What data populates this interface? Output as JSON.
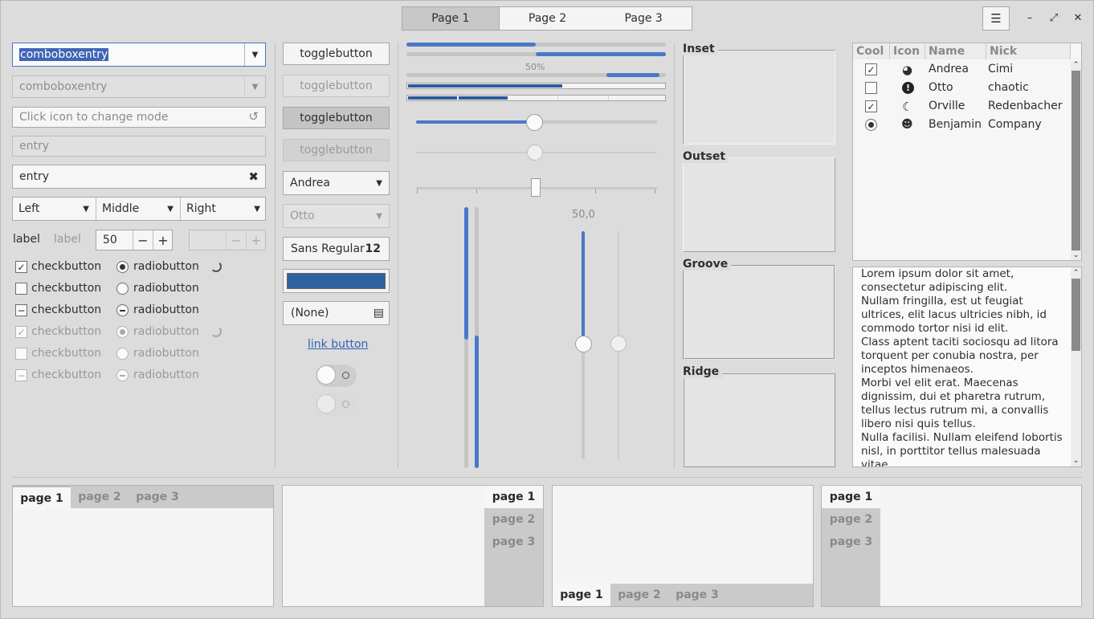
{
  "header": {
    "stack_tabs": [
      "Page 1",
      "Page 2",
      "Page 3"
    ],
    "menu_icon": "hamburger-icon",
    "controls": {
      "minimize": "–",
      "maximize": "⤢",
      "close": "✕"
    }
  },
  "left": {
    "combo1": "comboboxentry",
    "combo2": "comboboxentry",
    "mode_placeholder": "Click icon to change mode",
    "entry_disabled": "entry",
    "entry": "entry",
    "combos": [
      "Left",
      "Middle",
      "Right"
    ],
    "label1": "label",
    "label2": "label",
    "spin_value": "50",
    "spin_minus": "−",
    "spin_plus": "+",
    "check_label": "checkbutton",
    "radio_label": "radiobutton"
  },
  "buttons": {
    "toggle": "togglebutton",
    "combo_andrea": "Andrea",
    "combo_otto": "Otto",
    "font_name": "Sans Regular",
    "font_size": "12",
    "file_none": "(None)",
    "link": "link button",
    "color": "#2f62a0"
  },
  "progress": {
    "label": "50%",
    "scale_value": "50,0",
    "scale_fraction": 0.5
  },
  "frames": [
    "Inset",
    "Outset",
    "Groove",
    "Ridge"
  ],
  "tree": {
    "columns": [
      "Cool",
      "Icon",
      "Name",
      "Nick"
    ],
    "rows": [
      {
        "cool": "check",
        "icon": "pie-icon",
        "name": "Andrea",
        "nick": "Cimi"
      },
      {
        "cool": "empty",
        "icon": "alert-icon",
        "name": "Otto",
        "nick": "chaotic"
      },
      {
        "cool": "check",
        "icon": "moon-icon",
        "name": "Orville",
        "nick": "Redenbacher"
      },
      {
        "cool": "radio",
        "icon": "face-icon",
        "name": "Benjamin",
        "nick": "Company"
      }
    ]
  },
  "textview": [
    "Lorem ipsum dolor sit amet, consectetur adipiscing elit.",
    "Nullam fringilla, est ut feugiat ultrices, elit lacus ultricies nibh, id commodo tortor nisi id elit.",
    "Class aptent taciti sociosqu ad litora torquent per conubia nostra, per inceptos himenaeos.",
    "Morbi vel elit erat. Maecenas dignissim, dui et pharetra rutrum, tellus lectus rutrum mi, a convallis libero nisi quis tellus.",
    "Nulla facilisi. Nullam eleifend lobortis nisl, in porttitor tellus malesuada vitae."
  ],
  "notebooks": [
    "page 1",
    "page 2",
    "page 3"
  ],
  "colors": {
    "accent": "#4a78c9",
    "selection": "#3e65b6"
  }
}
